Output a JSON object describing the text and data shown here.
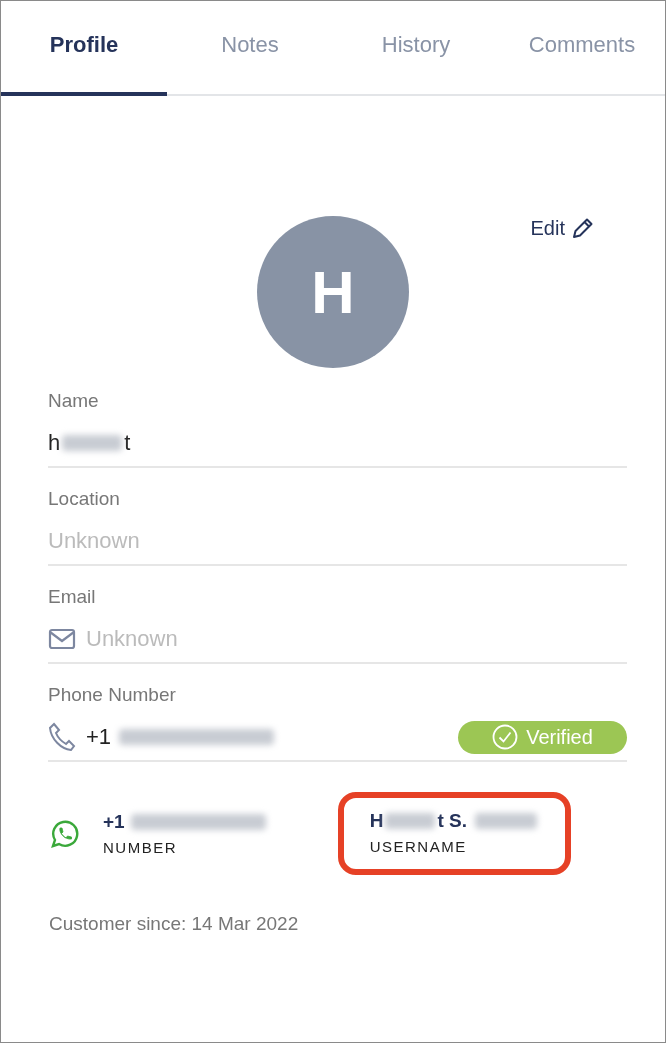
{
  "tabs": [
    {
      "label": "Profile",
      "selected": true
    },
    {
      "label": "Notes",
      "selected": false
    },
    {
      "label": "History",
      "selected": false
    },
    {
      "label": "Comments",
      "selected": false
    }
  ],
  "profile": {
    "avatar_initial": "H",
    "edit_label": "Edit",
    "fields": [
      {
        "kind": "name",
        "label": "Name",
        "parts": [
          {
            "kind": "text",
            "text": "h"
          },
          {
            "kind": "blurred"
          },
          {
            "kind": "text",
            "text": "t"
          }
        ]
      },
      {
        "kind": "location",
        "label": "Location",
        "placeholder": "Unknown"
      },
      {
        "kind": "email",
        "label": "Email",
        "placeholder": "Unknown"
      },
      {
        "kind": "phone",
        "label": "Phone Number",
        "parts": [
          {
            "kind": "text",
            "text": "+1"
          },
          {
            "kind": "blurred"
          }
        ],
        "badge": "Verified"
      }
    ],
    "whatsapp": {
      "number_parts": [
        {
          "kind": "text",
          "text": "+1"
        },
        {
          "kind": "blurred"
        }
      ],
      "number_caption": "NUMBER",
      "username_parts": [
        {
          "kind": "text",
          "text": "H"
        },
        {
          "kind": "blurred"
        },
        {
          "kind": "text",
          "text": "t S."
        },
        {
          "kind": "blurred"
        }
      ],
      "username_caption": "USERNAME",
      "username_highlighted": true
    },
    "customer_since": "Customer since: 14 Mar 2022"
  }
}
